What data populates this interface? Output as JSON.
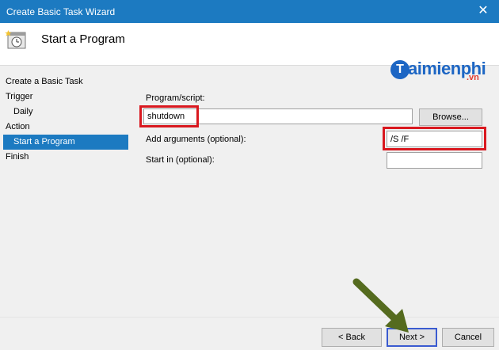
{
  "window": {
    "title": "Create Basic Task Wizard",
    "close_glyph": "✕"
  },
  "header": {
    "title": "Start a Program"
  },
  "watermark": {
    "mark": "T",
    "word": "aimienphi",
    "suffix": ".vn"
  },
  "nav": {
    "items": [
      {
        "label": "Create a Basic Task",
        "indent": false,
        "selected": false
      },
      {
        "label": "Trigger",
        "indent": false,
        "selected": false
      },
      {
        "label": "Daily",
        "indent": true,
        "selected": false
      },
      {
        "label": "Action",
        "indent": false,
        "selected": false
      },
      {
        "label": "Start a Program",
        "indent": true,
        "selected": true
      },
      {
        "label": "Finish",
        "indent": false,
        "selected": false
      }
    ]
  },
  "form": {
    "program_label": "Program/script:",
    "program_value": "shutdown",
    "browse_label": "Browse...",
    "args_label": "Add arguments (optional):",
    "args_value": "/S /F",
    "startin_label": "Start in (optional):",
    "startin_value": ""
  },
  "buttons": {
    "back": "< Back",
    "next": "Next >",
    "cancel": "Cancel"
  },
  "colors": {
    "titlebar": "#1c7ac1",
    "selection": "#1c7ac1",
    "highlight": "#d9181f",
    "arrow": "#556b1f"
  }
}
